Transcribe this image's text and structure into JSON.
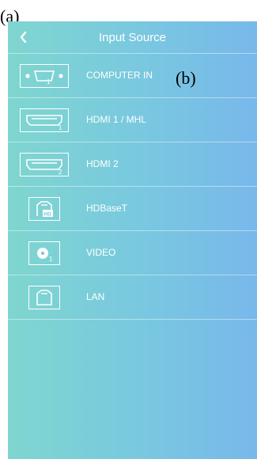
{
  "annotations": {
    "a": "(a)",
    "b": "(b)"
  },
  "header": {
    "title": "Input Source",
    "back_icon": "chevron-left-icon"
  },
  "sources": [
    {
      "label": "COMPUTER IN",
      "icon": "vga-port-icon",
      "port_number": "1"
    },
    {
      "label": "HDMI 1 / MHL",
      "icon": "hdmi-port-icon",
      "port_number": "1"
    },
    {
      "label": "HDMI 2",
      "icon": "hdmi-port-icon",
      "port_number": "2"
    },
    {
      "label": "HDBaseT",
      "icon": "hdbaset-port-icon",
      "port_number": "HD"
    },
    {
      "label": "VIDEO",
      "icon": "video-port-icon",
      "port_number": "1"
    },
    {
      "label": "LAN",
      "icon": "lan-port-icon",
      "port_number": ""
    }
  ],
  "colors": {
    "gradient_left": "#7fd6cf",
    "gradient_right": "#78b8ea",
    "foreground": "#ffffff"
  }
}
